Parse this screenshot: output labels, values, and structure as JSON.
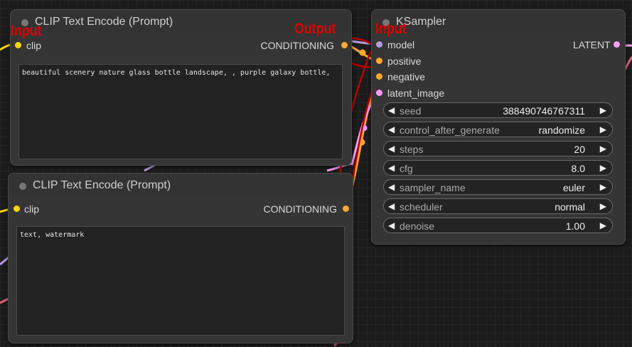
{
  "nodes": {
    "clip_positive": {
      "title": "CLIP Text Encode (Prompt)",
      "input_label": "clip",
      "output_label": "CONDITIONING",
      "text": "beautiful scenery nature glass bottle landscape, , purple galaxy bottle,"
    },
    "clip_negative": {
      "title": "CLIP Text Encode (Prompt)",
      "input_label": "clip",
      "output_label": "CONDITIONING",
      "text": "text, watermark"
    },
    "ksampler": {
      "title": "KSampler",
      "inputs": [
        "model",
        "positive",
        "negative",
        "latent_image"
      ],
      "output_label": "LATENT",
      "widgets": [
        {
          "name": "seed",
          "value": "388490746767311"
        },
        {
          "name": "control_after_generate",
          "value": "randomize"
        },
        {
          "name": "steps",
          "value": "20"
        },
        {
          "name": "cfg",
          "value": "8.0"
        },
        {
          "name": "sampler_name",
          "value": "euler"
        },
        {
          "name": "scheduler",
          "value": "normal"
        },
        {
          "name": "denoise",
          "value": "1.00"
        }
      ]
    }
  },
  "annotations": {
    "input_left": "Input",
    "output": "Output",
    "input_right": "Input"
  },
  "colors": {
    "clip_slot": "#ffd500",
    "conditioning_slot": "#ffa931",
    "model_slot": "#b39ddb",
    "latent_slot": "#ff9cf9",
    "annotation": "#e00000"
  }
}
